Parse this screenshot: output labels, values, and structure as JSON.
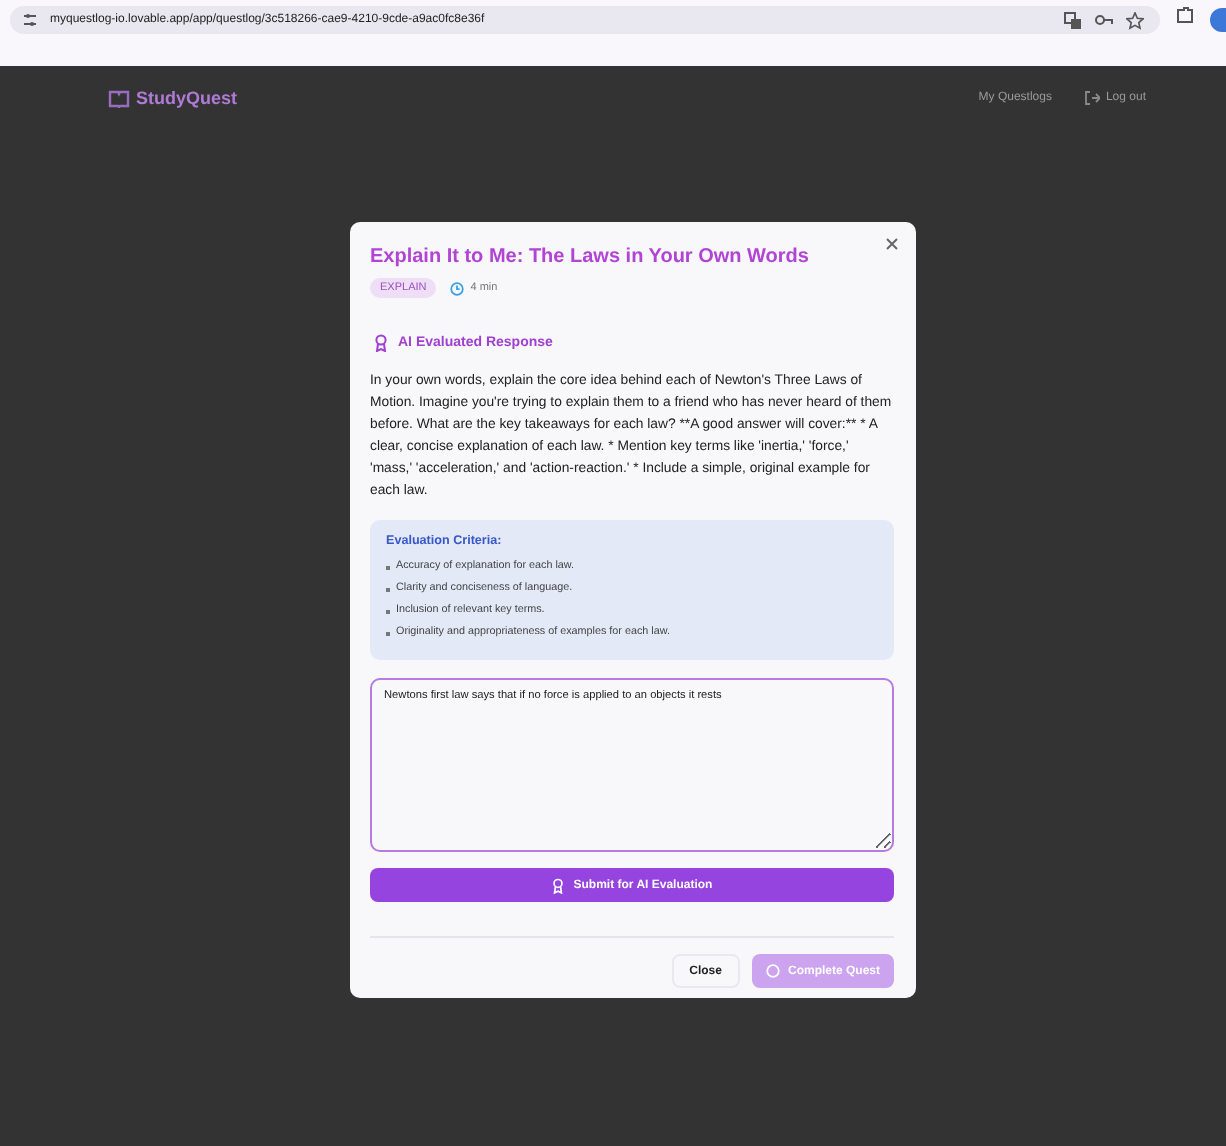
{
  "browser": {
    "url": "myquestlog-io.lovable.app/app/questlog/3c518266-cae9-4210-9cde-a9ac0fc8e36f"
  },
  "header": {
    "logo": "StudyQuest",
    "nav": [
      {
        "label": "My Questlogs",
        "kind": "link"
      },
      {
        "label": "Log out",
        "kind": "logout"
      }
    ]
  },
  "modal": {
    "title": "Explain It to Me: The Laws in Your Own Words",
    "tag": "EXPLAIN",
    "duration": "4 min",
    "section_title": "AI Evaluated Response",
    "prompt": "In your own words, explain the core idea behind each of Newton's Three Laws of Motion. Imagine you're trying to explain them to a friend who has never heard of them before. What are the key takeaways for each law? **A good answer will cover:** * A clear, concise explanation of each law. * Mention key terms like 'inertia,' 'force,' 'mass,' 'acceleration,' and 'action-reaction.' * Include a simple, original example for each law.",
    "criteria_title": "Evaluation Criteria:",
    "criteria": [
      "Accuracy of explanation for each law.",
      "Clarity and conciseness of language.",
      "Inclusion of relevant key terms.",
      "Originality and appropriateness of examples for each law."
    ],
    "answer": "Newtons first law says that if no force is applied to an objects it rests",
    "submit": "Submit for AI Evaluation",
    "close": "Close",
    "complete": {
      "label": "Complete Quest",
      "disabled": true
    }
  }
}
